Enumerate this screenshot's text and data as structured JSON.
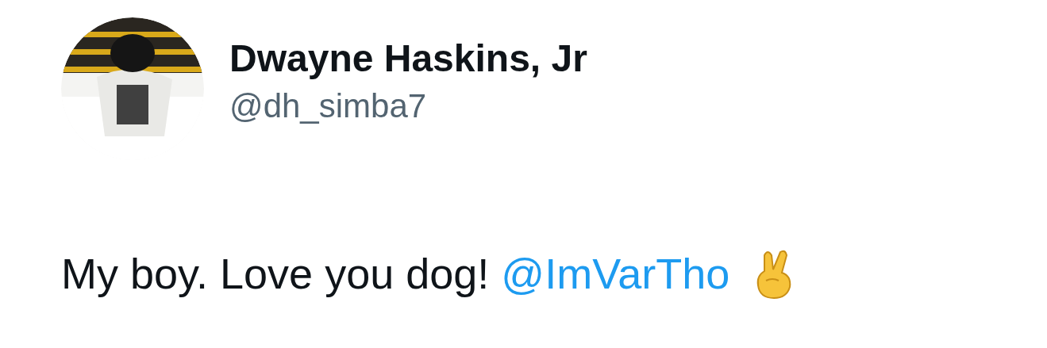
{
  "author": {
    "name": "Dwayne Haskins, Jr",
    "handle": "@dh_simba7"
  },
  "tweet": {
    "text": "My boy. Love you dog!",
    "mention": "@ImVarTho"
  }
}
